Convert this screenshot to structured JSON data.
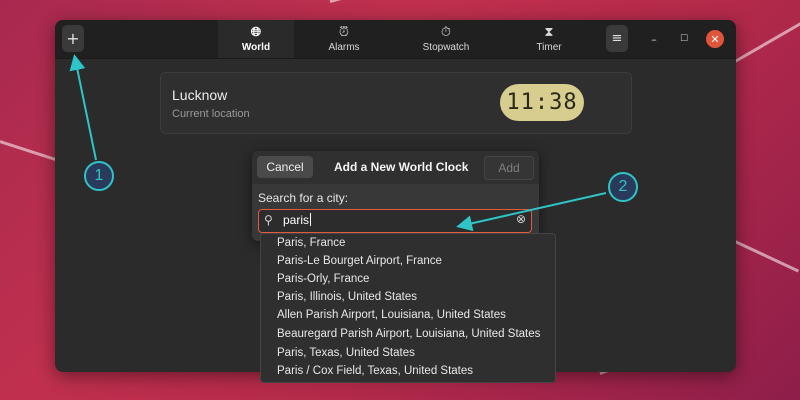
{
  "header": {
    "add_icon": "plus-icon",
    "tabs": [
      {
        "label": "World",
        "icon": "globe-icon",
        "active": true
      },
      {
        "label": "Alarms",
        "icon": "alarm-clock-icon",
        "active": false
      },
      {
        "label": "Stopwatch",
        "icon": "stopwatch-icon",
        "active": false
      },
      {
        "label": "Timer",
        "icon": "hourglass-icon",
        "active": false
      }
    ],
    "menu_icon": "hamburger-menu-icon",
    "window_controls": [
      "minimize-icon",
      "maximize-icon",
      "close-icon"
    ]
  },
  "location_card": {
    "city": "Lucknow",
    "subtitle": "Current location",
    "time": "11:38"
  },
  "dialog": {
    "cancel_label": "Cancel",
    "title": "Add a New World Clock",
    "add_label": "Add",
    "search_label": "Search for a city:",
    "search_value": "paris"
  },
  "results": [
    "Paris, France",
    "Paris-Le Bourget Airport, France",
    "Paris-Orly, France",
    "Paris, Illinois, United States",
    "Allen Parish Airport, Louisiana, United States",
    "Beauregard Parish Airport, Louisiana, United States",
    "Paris, Texas, United States",
    "Paris / Cox Field, Texas, United States"
  ],
  "annotations": [
    {
      "label": "1"
    },
    {
      "label": "2"
    }
  ],
  "colors": {
    "accent_focus": "#e05a3e",
    "annotation": "#2ec4c8",
    "clock_pill": "#d7cd8e"
  }
}
